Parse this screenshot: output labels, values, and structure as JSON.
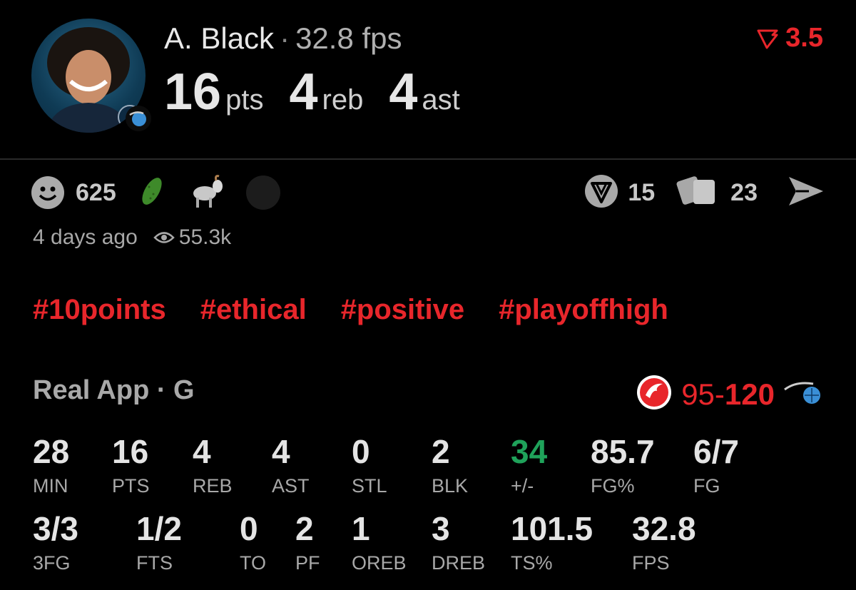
{
  "header": {
    "name": "A. Black",
    "separator": "·",
    "fps": "32.8 fps",
    "points": "16",
    "points_unit": "pts",
    "rebounds": "4",
    "rebounds_unit": "reb",
    "assists": "4",
    "assists_unit": "ast",
    "line": "3.5",
    "line_color": "#e8262b"
  },
  "reactions": {
    "smiley_count": "625",
    "icons": [
      "smiley-icon",
      "pickle-icon",
      "goat-icon",
      "dark-circle-icon"
    ]
  },
  "actions": {
    "bet_count": "15",
    "cards_count": "23",
    "icons": [
      "shield-v-icon",
      "cards-icon",
      "send-icon"
    ]
  },
  "meta": {
    "time_ago": "4 days ago",
    "views": "55.3k"
  },
  "tags": [
    "#10points",
    "#ethical",
    "#positive",
    "#playoffhigh"
  ],
  "game": {
    "source": "Real App · G",
    "score_left": "95",
    "score_sep": "-",
    "score_right": "120",
    "accent": "#e8262b",
    "positive": "#1fa25a"
  },
  "stats_row1": [
    {
      "value": "28",
      "label": "MIN"
    },
    {
      "value": "16",
      "label": "PTS"
    },
    {
      "value": "4",
      "label": "REB"
    },
    {
      "value": "4",
      "label": "AST"
    },
    {
      "value": "0",
      "label": "STL"
    },
    {
      "value": "2",
      "label": "BLK"
    },
    {
      "value": "34",
      "label": "+/-"
    },
    {
      "value": "85.7",
      "label": "FG%"
    },
    {
      "value": "6/7",
      "label": "FG"
    }
  ],
  "stats_row2": [
    {
      "value": "3/3",
      "label": "3FG"
    },
    {
      "value": "1/2",
      "label": "FTS"
    },
    {
      "value": "0",
      "label": "TO"
    },
    {
      "value": "2",
      "label": "PF"
    },
    {
      "value": "1",
      "label": "OREB"
    },
    {
      "value": "3",
      "label": "DREB"
    },
    {
      "value": "101.5",
      "label": "TS%"
    },
    {
      "value": "32.8",
      "label": "FPS"
    }
  ]
}
